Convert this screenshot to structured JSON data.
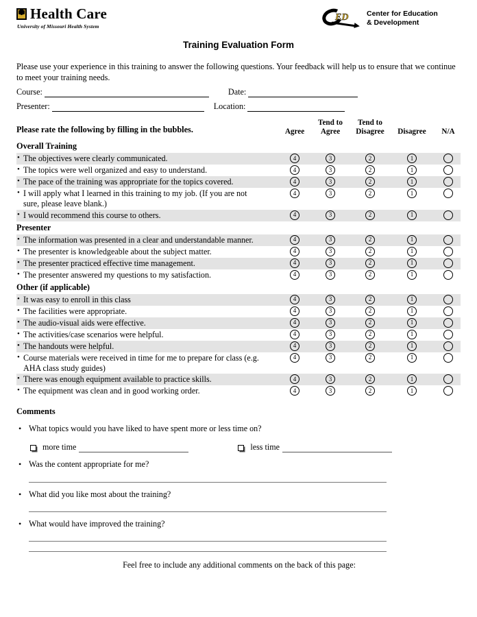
{
  "header": {
    "left_logo": {
      "mark": "mizzou-tiger-mark",
      "title": "Health Care",
      "subtitle": "University of Missouri Health System"
    },
    "right_logo": {
      "mark": "ced-arrow-logo",
      "monogram": "ED",
      "line1": "Center for Education",
      "line2": "& Development"
    }
  },
  "form_title": "Training Evaluation Form",
  "intro": "Please use your experience in this training to answer the following questions. Your feedback will help us to ensure that we continue to meet your training needs.",
  "fields": {
    "course_label": "Course:",
    "course_value": "",
    "date_label": "Date:",
    "date_value": "",
    "presenter_label": "Presenter:",
    "presenter_value": "",
    "location_label": "Location:",
    "location_value": ""
  },
  "rating": {
    "instruction": "Please rate the following by filling in the bubbles.",
    "columns": [
      {
        "label": "Agree",
        "line1": "",
        "line2": "Agree",
        "value": "4"
      },
      {
        "label": "Tend to Agree",
        "line1": "Tend to",
        "line2": "Agree",
        "value": "3"
      },
      {
        "label": "Tend to Disagree",
        "line1": "Tend to",
        "line2": "Disagree",
        "value": "2"
      },
      {
        "label": "Disagree",
        "line1": "",
        "line2": "Disagree",
        "value": "1"
      },
      {
        "label": "N/A",
        "line1": "",
        "line2": "N/A",
        "value": ""
      }
    ],
    "sections": [
      {
        "heading": "Overall Training",
        "items": [
          {
            "text": "The objectives were clearly communicated.",
            "cont": "",
            "shaded": true
          },
          {
            "text": "The topics were well organized and easy to understand.",
            "cont": "",
            "shaded": false
          },
          {
            "text": "The pace of the training was appropriate for the topics covered.",
            "cont": "",
            "shaded": true
          },
          {
            "text": "I will apply what I learned in this training to my job. (If you are not",
            "cont": "sure, please leave blank.)",
            "shaded": false
          },
          {
            "text": "I would recommend this course to others.",
            "cont": "",
            "shaded": true
          }
        ]
      },
      {
        "heading": "Presenter",
        "items": [
          {
            "text": "The information was presented in a clear and understandable manner.",
            "cont": "",
            "shaded": true
          },
          {
            "text": "The presenter is knowledgeable about the subject matter.",
            "cont": "",
            "shaded": false
          },
          {
            "text": "The presenter practiced effective time management.",
            "cont": "",
            "shaded": true
          },
          {
            "text": "The presenter answered my questions to my satisfaction.",
            "cont": "",
            "shaded": false
          }
        ]
      },
      {
        "heading": "Other (if applicable)",
        "items": [
          {
            "text": "It was easy to enroll in this class",
            "cont": "",
            "shaded": true
          },
          {
            "text": "The facilities were appropriate.",
            "cont": "",
            "shaded": false
          },
          {
            "text": "The audio-visual aids were effective.",
            "cont": "",
            "shaded": true
          },
          {
            "text": "The activities/case scenarios were helpful.",
            "cont": "",
            "shaded": false
          },
          {
            "text": "The handouts were helpful.",
            "cont": "",
            "shaded": true
          },
          {
            "text": "Course materials were received in time for me to prepare for class (e.g.",
            "cont": "AHA class study guides)",
            "shaded": false
          },
          {
            "text": "There was enough equipment available to practice skills.",
            "cont": "",
            "shaded": true
          },
          {
            "text": "The equipment was clean and in good working order.",
            "cont": "",
            "shaded": false
          }
        ]
      }
    ]
  },
  "comments": {
    "heading": "Comments",
    "q1": "What topics would you have liked to have spent more or less time on?",
    "more_time_label": "more time",
    "more_time_value": "",
    "less_time_label": "less time",
    "less_time_value": "",
    "q2": "Was the content appropriate for me?",
    "q2_answer": "",
    "q3": "What did you like most about the training?",
    "q3_answer": "",
    "q4": "What would have improved the training?",
    "q4_answer_line1": "",
    "q4_answer_line2": "",
    "footer_note": "Feel free to include any additional comments on the back of this page:"
  },
  "colors": {
    "row_shade": "#e3e3e3",
    "gold": "#d5ac2e",
    "ink": "#000000"
  }
}
